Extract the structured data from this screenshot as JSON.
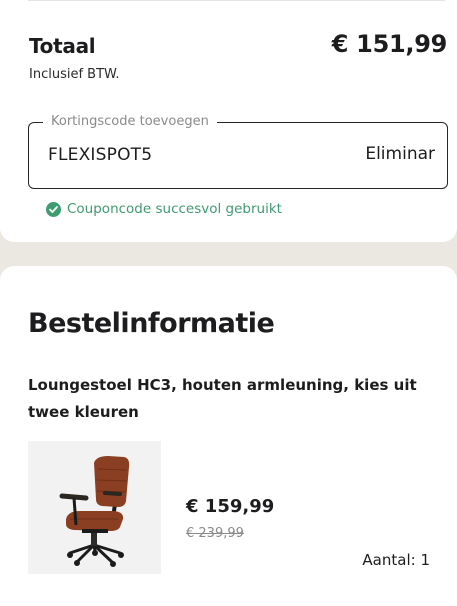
{
  "summary": {
    "total_label": "Totaal",
    "total_value": "€ 151,99",
    "vat_note": "Inclusief BTW."
  },
  "coupon": {
    "legend": "Kortingscode toevoegen",
    "value": "FLEXISPOT5",
    "remove_label": "Eliminar",
    "status": "Couponcode succesvol gebruikt",
    "status_icon": "check-circle-icon"
  },
  "order": {
    "title": "Bestelinformatie",
    "product": {
      "name": "Loungestoel HC3, houten armleuning, kies uit twee kleuren",
      "price_current": "€ 159,99",
      "price_old": "€ 239,99",
      "quantity": "Aantal: 1"
    }
  },
  "colors": {
    "success": "#3f9b70",
    "background": "#ebe7e1",
    "text": "#1d1d1f",
    "chair_leather": "#8b3f22"
  }
}
